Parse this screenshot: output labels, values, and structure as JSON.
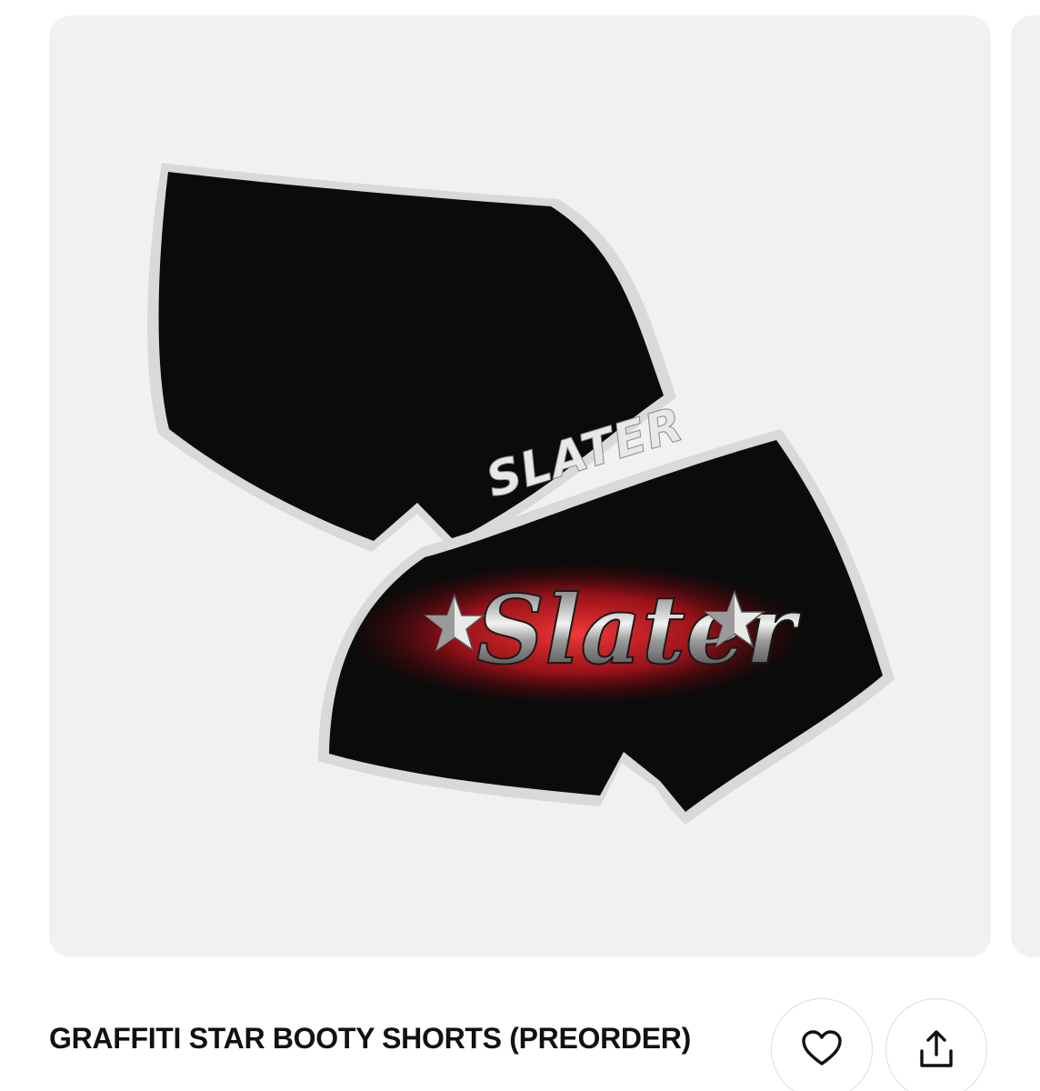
{
  "product": {
    "title": "GRAFFITI STAR BOOTY SHORTS (PREORDER)",
    "image": {
      "description_icon": "product-image",
      "front_print_text": "SLATER",
      "back_print_text": "Slater",
      "garment_color": "#0b0b0b",
      "piping_color": "#d9d9d9",
      "accent_color": "#d0202a"
    }
  },
  "actions": {
    "favorite_icon": "heart-icon",
    "share_icon": "share-icon"
  },
  "colors": {
    "card_background": "#f1f1f1",
    "text": "#111111",
    "button_border": "#dddddd"
  }
}
